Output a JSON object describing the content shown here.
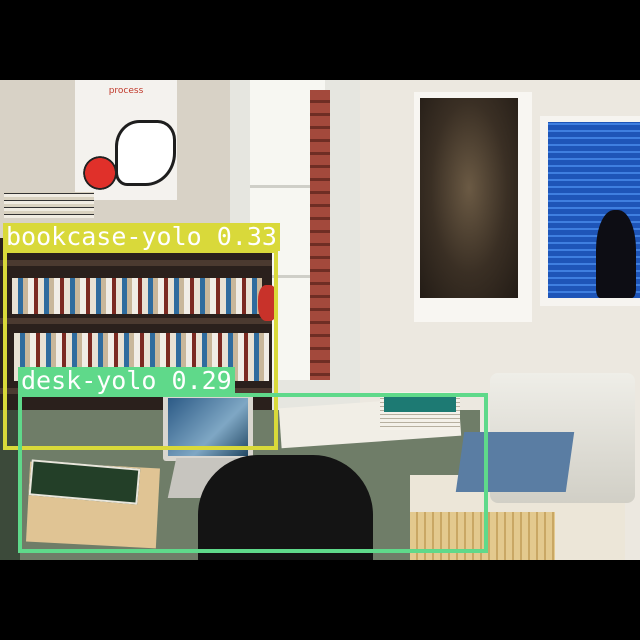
{
  "scene": {
    "poster_text": "process"
  },
  "detections": [
    {
      "name": "bookcase-yolo",
      "label": "bookcase-yolo 0.33",
      "class": "bookcase",
      "confidence": 0.33,
      "color": "#d9d93a"
    },
    {
      "name": "desk-yolo",
      "label": "desk-yolo 0.29",
      "class": "desk",
      "confidence": 0.29,
      "color": "#5fd98a"
    }
  ]
}
